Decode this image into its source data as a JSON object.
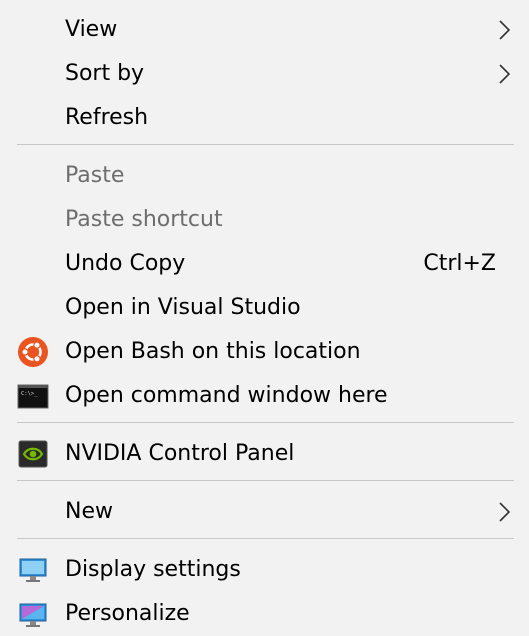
{
  "menu": {
    "items": {
      "view": {
        "label": "View",
        "icon": "chevron-right-icon"
      },
      "sort_by": {
        "label": "Sort by",
        "icon": "chevron-right-icon"
      },
      "refresh": {
        "label": "Refresh"
      },
      "paste": {
        "label": "Paste",
        "disabled": true
      },
      "paste_shortcut": {
        "label": "Paste shortcut",
        "disabled": true
      },
      "undo_copy": {
        "label": "Undo Copy",
        "shortcut": "Ctrl+Z"
      },
      "open_visual_studio": {
        "label": "Open in Visual Studio"
      },
      "open_bash": {
        "label": "Open Bash on this location",
        "icon": "ubuntu-icon"
      },
      "open_cmd": {
        "label": "Open command window here",
        "icon": "command-prompt-icon"
      },
      "nvidia": {
        "label": "NVIDIA Control Panel",
        "icon": "nvidia-icon"
      },
      "new": {
        "label": "New",
        "icon": "chevron-right-icon"
      },
      "display_settings": {
        "label": "Display settings",
        "icon": "monitor-icon"
      },
      "personalize": {
        "label": "Personalize",
        "icon": "personalize-icon"
      }
    }
  },
  "colors": {
    "background": "#f2f2f2",
    "separator": "#c7c7c7",
    "disabled_text": "#6d6d6d",
    "ubuntu_orange": "#e95420",
    "nvidia_green": "#76b900"
  }
}
